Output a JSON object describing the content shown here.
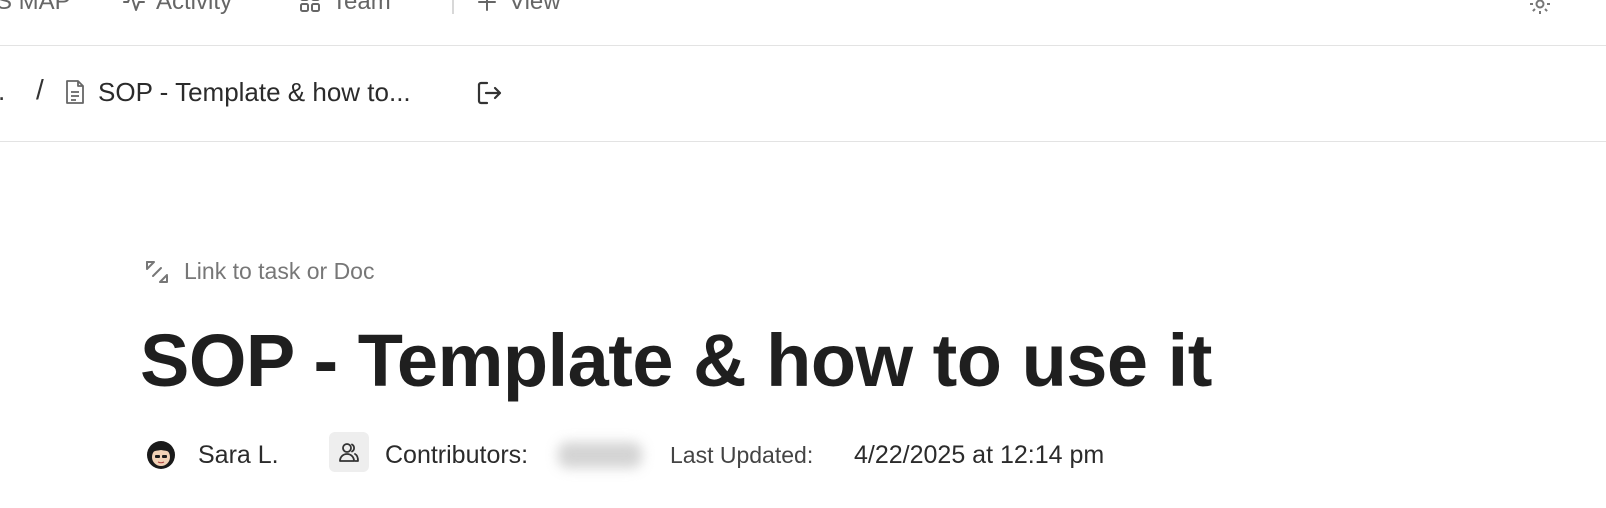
{
  "topbar": {
    "items": [
      {
        "label": "S MAP",
        "icon": "map-icon"
      },
      {
        "label": "Activity",
        "icon": "activity-icon"
      },
      {
        "label": "Team",
        "icon": "team-grid-icon"
      },
      {
        "label": "View",
        "icon": "plus-icon"
      }
    ]
  },
  "breadcrumb": {
    "ellipsis": ".",
    "separator": "/",
    "doc_title": "SOP - Template & how to...",
    "doc_icon": "document-icon",
    "exit_icon": "exit-doc-icon"
  },
  "doc": {
    "link_label": "Link to task or Doc",
    "link_icon": "link-arrows-icon",
    "title": "SOP - Template & how to use it",
    "author": "Sara L.",
    "contributors_label": "Contributors:",
    "last_updated_label": "Last Updated:",
    "last_updated_value": "4/22/2025 at 12:14 pm"
  }
}
